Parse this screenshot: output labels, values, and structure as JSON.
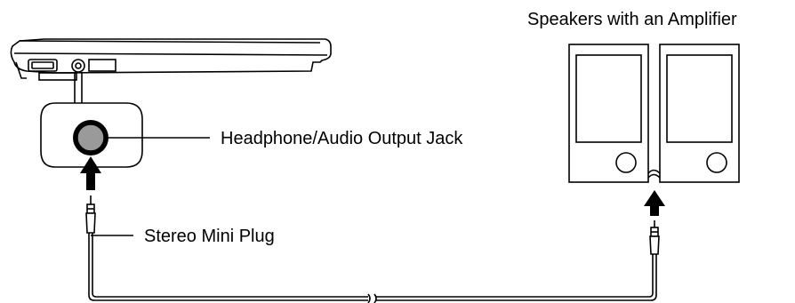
{
  "labels": {
    "speakers": "Speakers with an Amplifier",
    "jack": "Headphone/Audio Output Jack",
    "plug": "Stereo Mini Plug"
  },
  "colors": {
    "line": "#000000",
    "jack_ring": "#9a9a9a",
    "background": "#ffffff"
  },
  "icons": {
    "laptop": "laptop-side-view-icon",
    "jack": "audio-jack-icon",
    "speakers": "speaker-pair-icon",
    "plug": "stereo-mini-plug-icon",
    "arrow": "up-arrow-icon"
  }
}
